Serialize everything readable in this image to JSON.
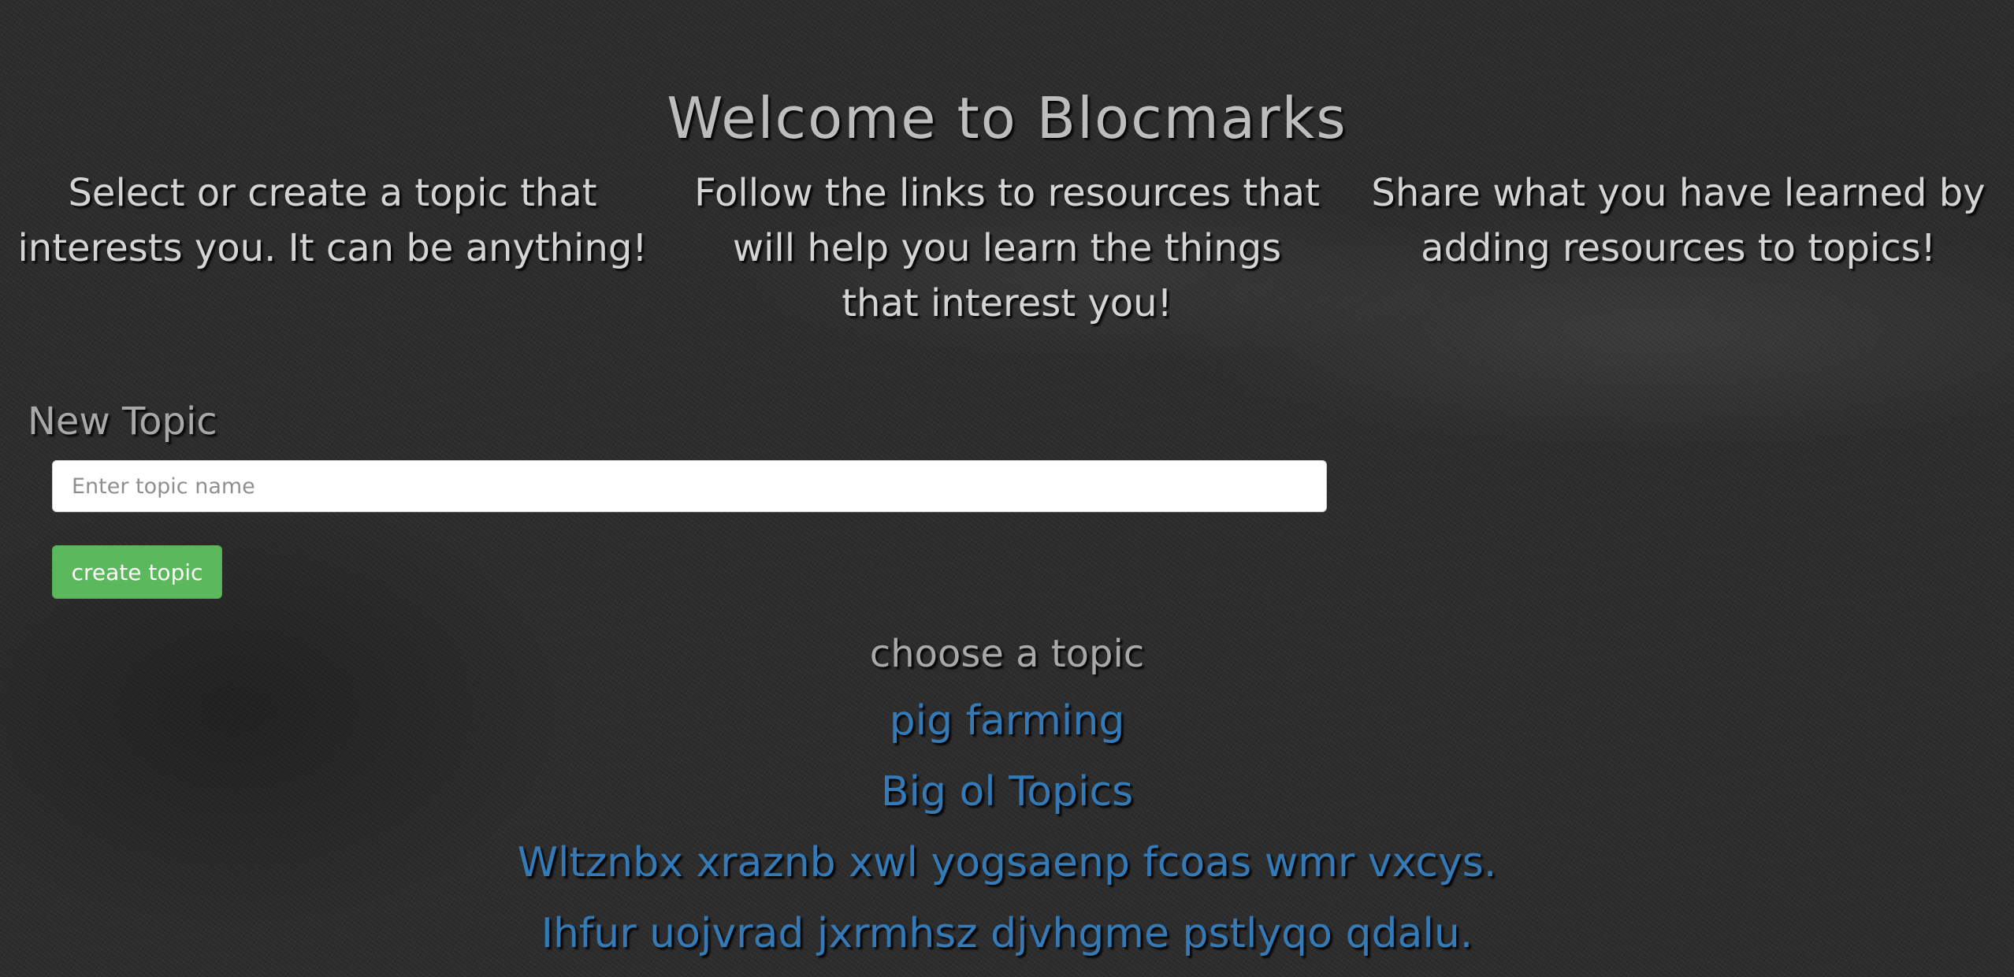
{
  "header": {
    "title": "Welcome to Blocmarks"
  },
  "intro": {
    "columns": [
      "Select or create a topic that interests you. It can be anything!",
      "Follow the links to resources that will help you learn the things that interest you!",
      "Share what you have learned by adding resources to topics!"
    ]
  },
  "new_topic": {
    "label": "New Topic",
    "input_placeholder": "Enter topic name",
    "input_value": "",
    "submit_label": "create topic"
  },
  "topics": {
    "heading": "choose a topic",
    "items": [
      "pig farming",
      "Big ol Topics",
      "Wltznbx xraznb xwl yogsaenp fcoas wmr vxcys.",
      "Ihfur uojvrad jxrmhsz djvhgme pstlyqo qdalu."
    ]
  },
  "colors": {
    "background": "#2c2c2c",
    "link": "#337ab7",
    "button": "#5cb85c"
  }
}
